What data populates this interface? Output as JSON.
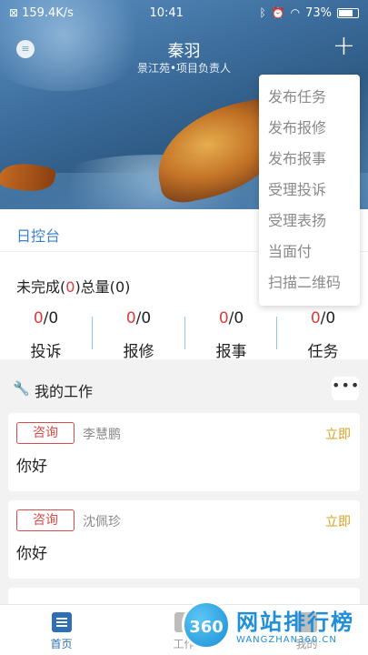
{
  "status_bar": {
    "network_speed": "159.4K/s",
    "time": "10:41",
    "battery": "73%"
  },
  "header": {
    "name": "秦羽",
    "role": "景江苑•项目负责人"
  },
  "popup_menu": {
    "items": [
      "发布任务",
      "发布报修",
      "发布报事",
      "受理投诉",
      "受理表扬",
      "当面付",
      "扫描二维码"
    ]
  },
  "console": {
    "title": "日控台",
    "summary_prefix": "未完成(",
    "summary_count": "0",
    "summary_mid": ")总量(",
    "summary_total": "0",
    "summary_suffix": ")",
    "stats": [
      {
        "done": "0",
        "total": "/0",
        "label": "投诉"
      },
      {
        "done": "0",
        "total": "/0",
        "label": "报修"
      },
      {
        "done": "0",
        "total": "/0",
        "label": "报事"
      },
      {
        "done": "0",
        "total": "/0",
        "label": "任务"
      }
    ]
  },
  "work": {
    "title": "我的工作",
    "more_label": "•••",
    "cards": [
      {
        "type": "咨询",
        "name": "李慧鹏",
        "action": "立即",
        "text": "你好"
      },
      {
        "type": "咨询",
        "name": "沈佩珍",
        "action": "立即",
        "text": "你好"
      }
    ]
  },
  "tabbar": {
    "tabs": [
      "首页",
      "工作",
      "我的"
    ]
  },
  "watermark": {
    "logo": "360",
    "title": "网站排行榜",
    "sub": "WANGZHAN360.CN"
  }
}
